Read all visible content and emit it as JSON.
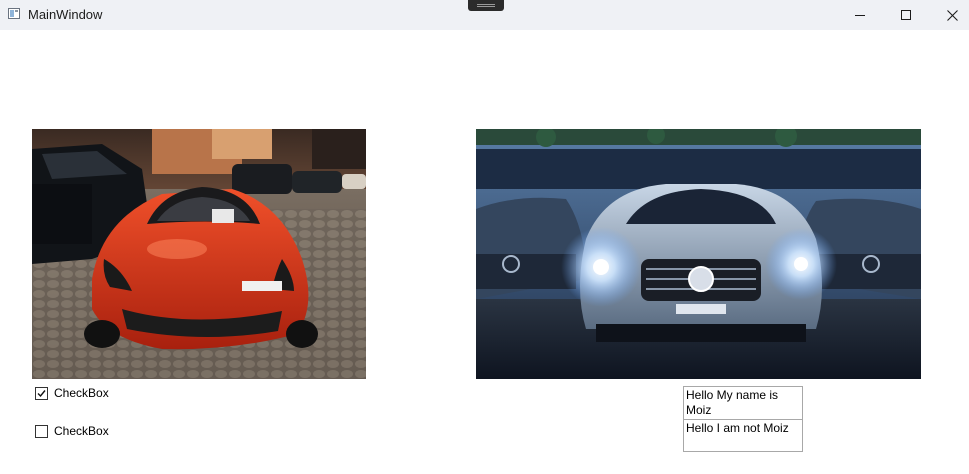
{
  "window": {
    "title": "MainWindow",
    "icon": "app-window-icon",
    "controls": [
      "minimize-icon",
      "maximize-icon",
      "close-icon"
    ]
  },
  "images": [
    {
      "subject": "red-ferrari-photo"
    },
    {
      "subject": "silver-mercedes-photo"
    }
  ],
  "checkboxes": [
    {
      "label": "CheckBox",
      "checked": true
    },
    {
      "label": "CheckBox",
      "checked": false
    }
  ],
  "listbox": {
    "items": [
      "Hello My name is Moiz",
      "Hello I am not Moiz"
    ]
  },
  "colors": {
    "titlebar": "#eff1f5",
    "window_background": "#ffffff"
  }
}
